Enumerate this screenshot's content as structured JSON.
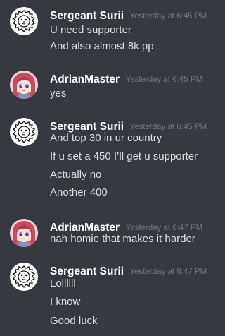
{
  "messages": [
    {
      "author": "Sergeant Surii",
      "avatar": "lion-avatar-icon",
      "timestamp": "Yesterday at 6:45 PM",
      "lines": [
        "U need supporter",
        "And also almost 8k pp"
      ]
    },
    {
      "author": "AdrianMaster",
      "avatar": "anime-girl-avatar-icon",
      "timestamp": "Yesterday at 6:45 PM",
      "lines": [
        "yes"
      ]
    },
    {
      "author": "Sergeant Surii",
      "avatar": "lion-avatar-icon",
      "timestamp": "Yesterday at 6:45 PM",
      "lines": [
        "And top 30 in ur country",
        "If u set a 450 I’ll get u supporter",
        "Actually no",
        "Another 400"
      ]
    },
    {
      "author": "AdrianMaster",
      "avatar": "anime-girl-avatar-icon",
      "timestamp": "Yesterday at 6:47 PM",
      "lines": [
        "nah homie that makes it harder"
      ]
    },
    {
      "author": "Sergeant Surii",
      "avatar": "lion-avatar-icon",
      "timestamp": "Yesterday at 6:47 PM",
      "lines": [
        "Lollllll",
        "I know",
        "Good luck"
      ]
    }
  ],
  "colors": {
    "background": "#36393f",
    "username": "#ffffff",
    "timestamp": "#72767d",
    "message_text": "#dcddde"
  }
}
